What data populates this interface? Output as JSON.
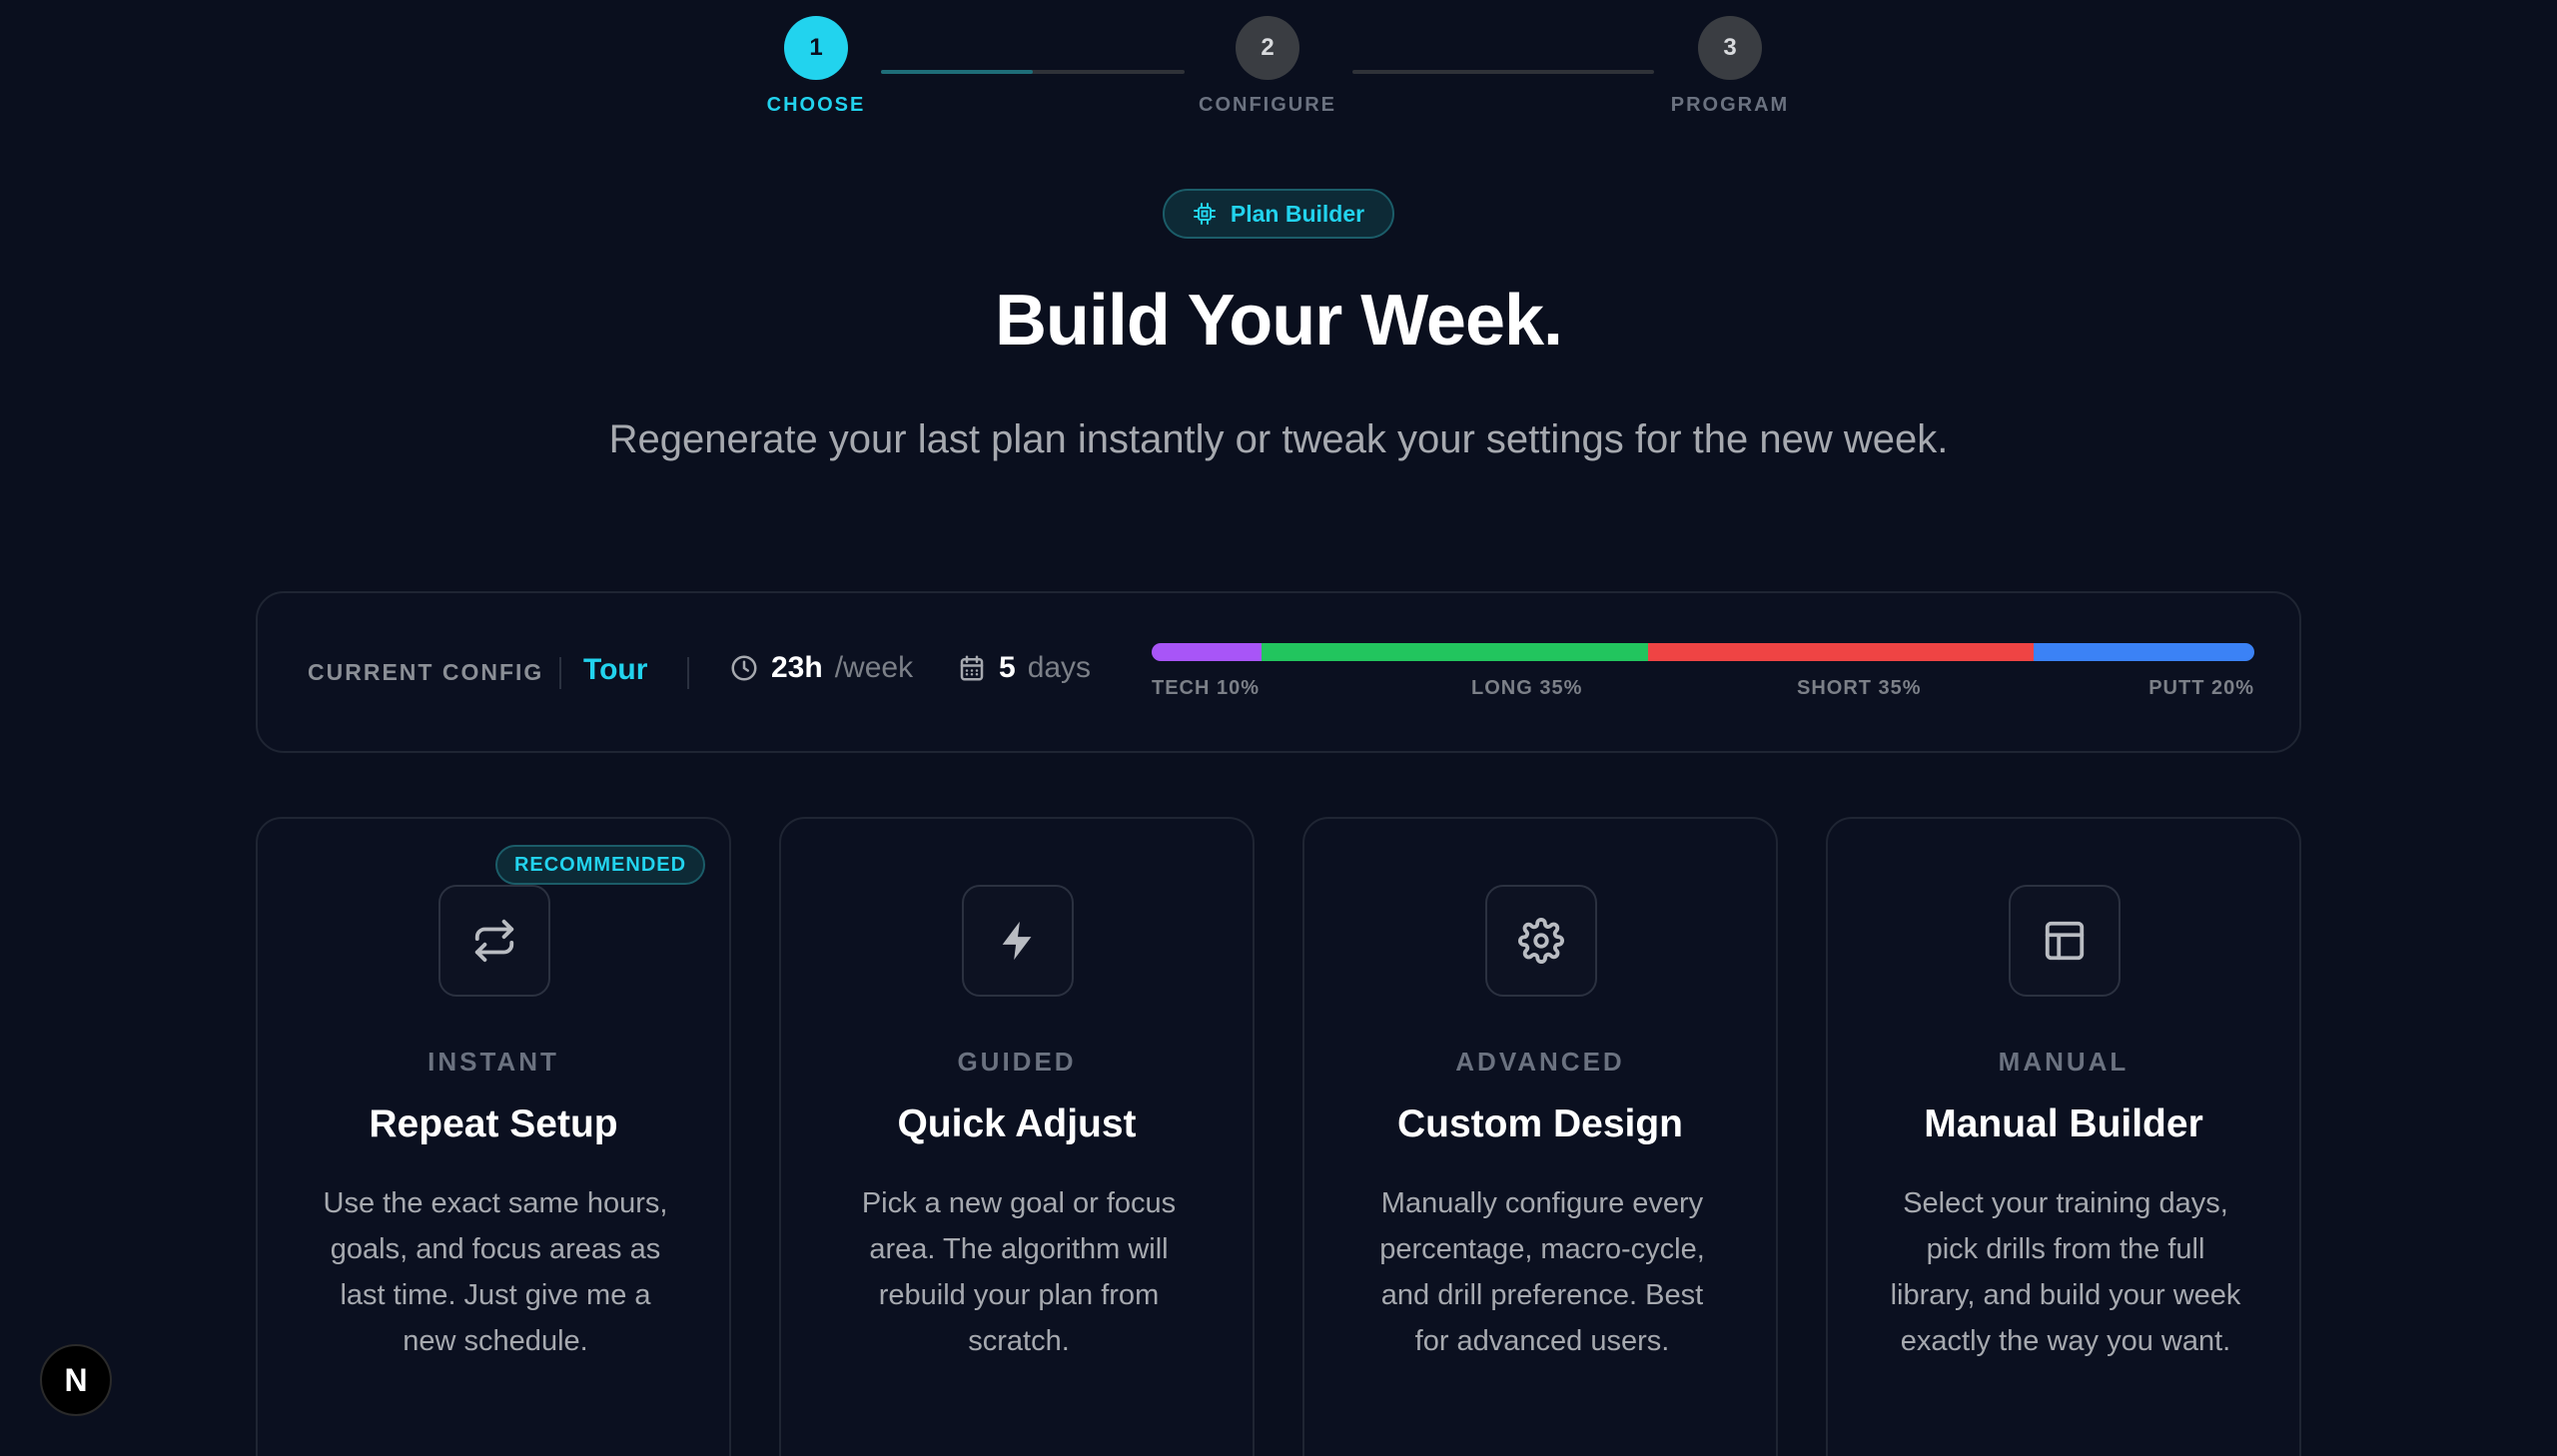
{
  "stepper": {
    "steps": [
      {
        "number": "1",
        "label": "CHOOSE",
        "active": true
      },
      {
        "number": "2",
        "label": "CONFIGURE",
        "active": false
      },
      {
        "number": "3",
        "label": "PROGRAM",
        "active": false
      }
    ],
    "progress_first_segment": 0.5
  },
  "badge": {
    "label": "Plan Builder",
    "icon": "chip-icon"
  },
  "hero": {
    "title": "Build Your Week.",
    "subtitle": "Regenerate your last plan instantly or tweak your settings for the new week."
  },
  "config": {
    "label": "CURRENT CONFIG",
    "mode": "Tour",
    "hours_value": "23h",
    "hours_unit": "/week",
    "days_value": "5",
    "days_unit": "days",
    "distribution": [
      {
        "label": "TECH 10%",
        "percent": 10,
        "color": "#a855f7"
      },
      {
        "label": "LONG 35%",
        "percent": 35,
        "color": "#22c55e"
      },
      {
        "label": "SHORT 35%",
        "percent": 35,
        "color": "#ef4444"
      },
      {
        "label": "PUTT 20%",
        "percent": 20,
        "color": "#3b82f6"
      }
    ]
  },
  "cards": [
    {
      "kicker": "INSTANT",
      "title": "Repeat Setup",
      "description": "Use the exact same hours, goals, and focus areas as last time. Just give me a new schedule.",
      "badge": "RECOMMENDED",
      "icon": "repeat-icon"
    },
    {
      "kicker": "GUIDED",
      "title": "Quick Adjust",
      "description": "Pick a new goal or focus area. The algorithm will rebuild your plan from scratch.",
      "icon": "lightning-icon"
    },
    {
      "kicker": "ADVANCED",
      "title": "Custom Design",
      "description": "Manually configure every percentage, macro-cycle, and drill preference. Best for advanced users.",
      "icon": "gear-icon"
    },
    {
      "kicker": "MANUAL",
      "title": "Manual Builder",
      "description": "Select your training days, pick drills from the full library, and build your week exactly the way you want.",
      "icon": "layout-icon"
    }
  ],
  "dev_badge": {
    "label": "N"
  },
  "colors": {
    "accent": "#22d3ee",
    "background": "#0a0f1e"
  }
}
